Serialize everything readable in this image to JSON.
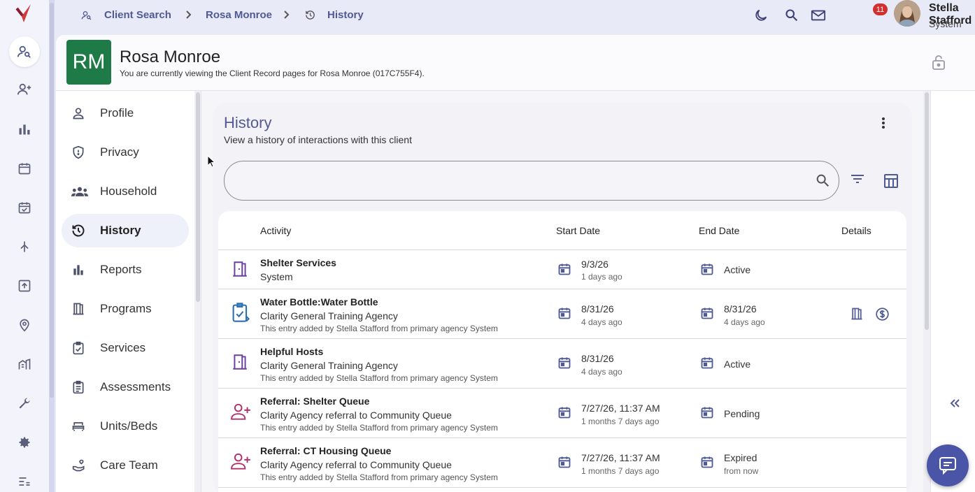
{
  "breadcrumb": [
    {
      "label": "Client Search",
      "icon": "person-search-icon"
    },
    {
      "label": "Rosa Monroe"
    },
    {
      "label": "History",
      "icon": "history-icon"
    }
  ],
  "topbar": {
    "mail_badge": "11",
    "user_name": "Stella Stafford",
    "user_role": "System"
  },
  "client": {
    "initials": "RM",
    "name": "Rosa Monroe",
    "subtitle": "You are currently viewing the Client Record pages for Rosa Monroe (017C755F4).",
    "initials_color": "#1e7a46"
  },
  "client_nav": [
    {
      "label": "Profile",
      "icon": "person-icon"
    },
    {
      "label": "Privacy",
      "icon": "shield-icon"
    },
    {
      "label": "Household",
      "icon": "group-icon"
    },
    {
      "label": "History",
      "icon": "history-icon",
      "selected": true
    },
    {
      "label": "Reports",
      "icon": "bar-chart-icon"
    },
    {
      "label": "Programs",
      "icon": "door-icon"
    },
    {
      "label": "Services",
      "icon": "clipboard-check-icon"
    },
    {
      "label": "Assessments",
      "icon": "clipboard-list-icon"
    },
    {
      "label": "Units/Beds",
      "icon": "bed-icon"
    },
    {
      "label": "Care Team",
      "icon": "hand-heart-icon"
    }
  ],
  "history": {
    "title": "History",
    "subtitle": "View a history of interactions with this client",
    "search_value": "",
    "columns": {
      "activity": "Activity",
      "start": "Start Date",
      "end": "End Date",
      "details": "Details"
    },
    "rows": [
      {
        "icon": "door-icon",
        "activity": "Shelter Services",
        "org": "System",
        "note": "",
        "start": "9/3/26",
        "start_rel": "1 days ago",
        "end": "Active",
        "end_rel": "",
        "details": []
      },
      {
        "icon": "clipboard-check-icon",
        "activity": "Water Bottle:Water Bottle",
        "org": "Clarity General Training Agency",
        "note": "This entry added by Stella Stafford from primary agency System",
        "start": "8/31/26",
        "start_rel": "4 days ago",
        "end": "8/31/26",
        "end_rel": "4 days ago",
        "details": [
          "door-icon",
          "dollar-icon"
        ]
      },
      {
        "icon": "door-icon",
        "activity": "Helpful Hosts",
        "org": "Clarity General Training Agency",
        "note": "This entry added by Stella Stafford from primary agency System",
        "start": "8/31/26",
        "start_rel": "4 days ago",
        "end": "Active",
        "end_rel": "",
        "details": []
      },
      {
        "icon": "person-add-icon",
        "activity": "Referral: Shelter Queue",
        "org": "Clarity Agency referral to Community Queue",
        "note": "This entry added by Stella Stafford from primary agency System",
        "start": "7/27/26, 11:37 AM",
        "start_rel": "1 months 7 days ago",
        "end": "Pending",
        "end_rel": "",
        "details": []
      },
      {
        "icon": "person-add-icon",
        "activity": "Referral: CT Housing Queue",
        "org": "Clarity Agency referral to Community Queue",
        "note": "This entry added by Stella Stafford from primary agency System",
        "start": "7/27/26, 11:37 AM",
        "start_rel": "1 months 7 days ago",
        "end": "Expired",
        "end_rel": "from now",
        "details": []
      }
    ]
  },
  "colors": {
    "accent": "#4f5a94",
    "program_icon": "#6b3fa0",
    "referral_icon": "#b0306a",
    "service_icon": "#2a6fb3"
  }
}
